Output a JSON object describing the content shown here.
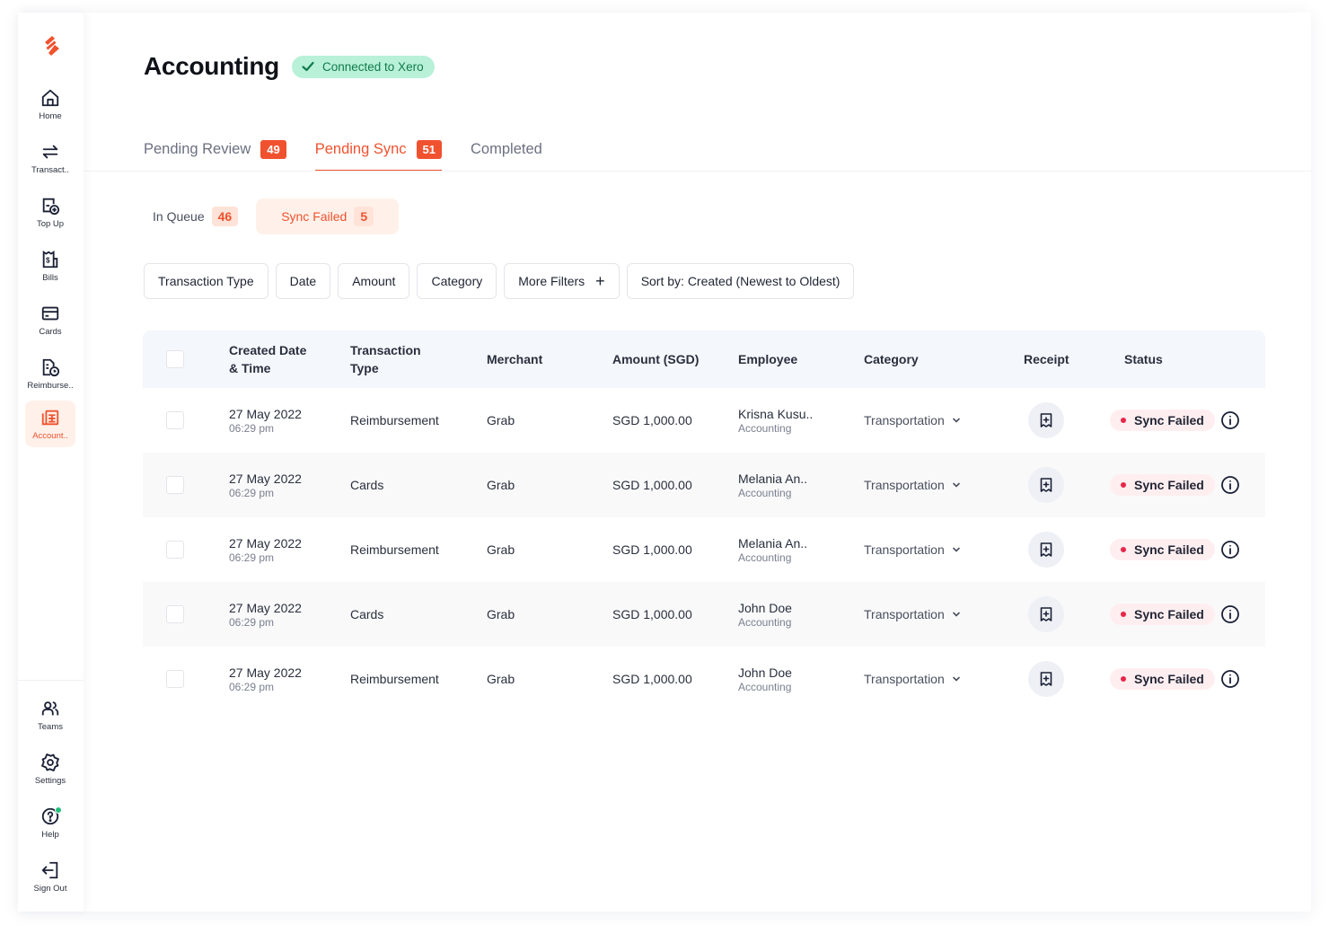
{
  "app": {
    "brand_color": "#f0522f",
    "logo_icon": "brand-logo"
  },
  "sidebar": {
    "items": [
      {
        "label": "Home",
        "icon": "home-icon"
      },
      {
        "label": "Transact..",
        "icon": "transfer-arrows-icon"
      },
      {
        "label": "Top Up",
        "icon": "wallet-plus-icon"
      },
      {
        "label": "Bills",
        "icon": "receipt-dollar-icon"
      },
      {
        "label": "Cards",
        "icon": "credit-card-icon"
      },
      {
        "label": "Reimburse..",
        "icon": "document-clock-icon"
      },
      {
        "label": "Account..",
        "icon": "ledger-icon",
        "active": true
      }
    ],
    "bottom_items": [
      {
        "label": "Teams",
        "icon": "users-icon"
      },
      {
        "label": "Settings",
        "icon": "gear-icon"
      },
      {
        "label": "Help",
        "icon": "help-icon",
        "notification_dot_color": "#21c17a"
      },
      {
        "label": "Sign Out",
        "icon": "sign-out-icon"
      }
    ]
  },
  "header": {
    "title": "Accounting",
    "connection_badge": {
      "label": "Connected to Xero",
      "icon": "check-icon",
      "bg": "#b8f1d8",
      "color": "#117a4d"
    }
  },
  "tabs": [
    {
      "label": "Pending Review",
      "count": "49"
    },
    {
      "label": "Pending Sync",
      "count": "51",
      "active": true
    },
    {
      "label": "Completed"
    }
  ],
  "subtabs": [
    {
      "label": "In Queue",
      "count": "46"
    },
    {
      "label": "Sync Failed",
      "count": "5",
      "active": true
    }
  ],
  "filters": {
    "transaction_type": "Transaction Type",
    "date": "Date",
    "amount": "Amount",
    "category": "Category",
    "more_filters": "More Filters",
    "more_filters_icon": "+",
    "sort": "Sort by: Created (Newest to Oldest)"
  },
  "table": {
    "columns": {
      "created_line1": "Created Date",
      "created_line2": "& Time",
      "type_line1": "Transaction",
      "type_line2": "Type",
      "merchant": "Merchant",
      "amount": "Amount (SGD)",
      "employee": "Employee",
      "category": "Category",
      "receipt": "Receipt",
      "status": "Status"
    },
    "rows": [
      {
        "date": "27 May 2022",
        "time": "06:29 pm",
        "type": "Reimbursement",
        "merchant": "Grab",
        "amount": "SGD 1,000.00",
        "employee": "Krisna Kusu..",
        "department": "Accounting",
        "category": "Transportation",
        "status": "Sync Failed"
      },
      {
        "date": "27 May 2022",
        "time": "06:29 pm",
        "type": "Cards",
        "merchant": "Grab",
        "amount": "SGD 1,000.00",
        "employee": "Melania An..",
        "department": "Accounting",
        "category": "Transportation",
        "status": "Sync Failed"
      },
      {
        "date": "27 May 2022",
        "time": "06:29 pm",
        "type": "Reimbursement",
        "merchant": "Grab",
        "amount": "SGD 1,000.00",
        "employee": "Melania An..",
        "department": "Accounting",
        "category": "Transportation",
        "status": "Sync Failed"
      },
      {
        "date": "27 May 2022",
        "time": "06:29 pm",
        "type": "Cards",
        "merchant": "Grab",
        "amount": "SGD 1,000.00",
        "employee": "John Doe",
        "department": "Accounting",
        "category": "Transportation",
        "status": "Sync Failed"
      },
      {
        "date": "27 May 2022",
        "time": "06:29 pm",
        "type": "Reimbursement",
        "merchant": "Grab",
        "amount": "SGD 1,000.00",
        "employee": "John Doe",
        "department": "Accounting",
        "category": "Transportation",
        "status": "Sync Failed"
      }
    ],
    "status_color": "#e8264a"
  }
}
